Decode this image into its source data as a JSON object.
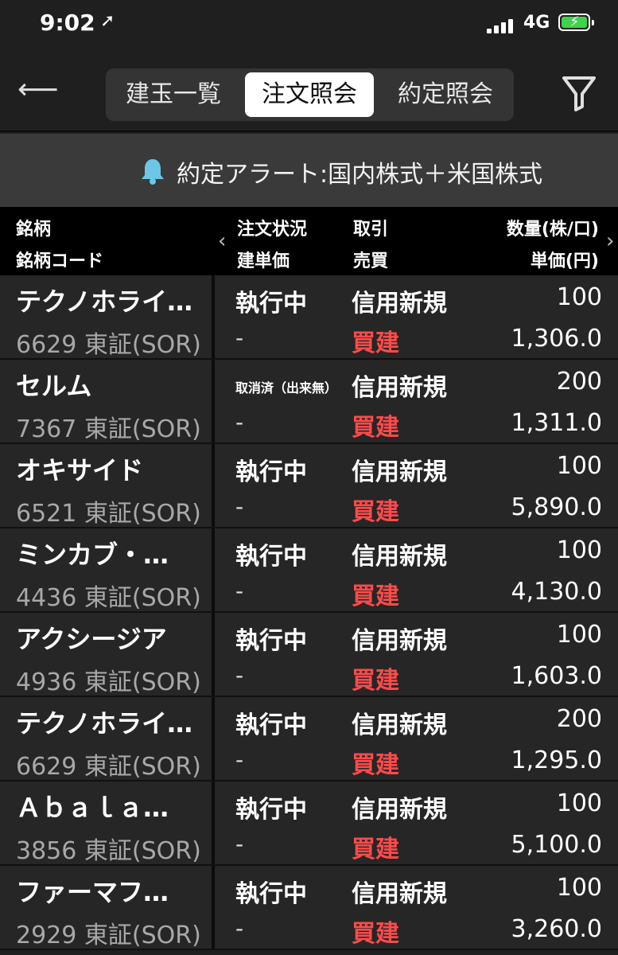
{
  "status_bar": {
    "time": "9:02",
    "network": "4G"
  },
  "nav": {
    "tabs": [
      "建玉一覧",
      "注文照会",
      "約定照会"
    ],
    "active_tab": 1
  },
  "alert": {
    "text": "約定アラート:国内株式＋米国株式"
  },
  "table": {
    "headers": {
      "name": "銘柄",
      "code": "銘柄コード",
      "status": "注文状況",
      "price": "建単価",
      "trade": "取引",
      "side": "売買",
      "qty": "数量(株/口)",
      "unit_price": "単価(円)"
    },
    "rows": [
      {
        "name": "テクノホライ…",
        "code": "6629 東証(SOR)",
        "status": "執行中",
        "price": "-",
        "trade": "信用新規",
        "side": "買建",
        "qty": "100",
        "unit_price": "1,306.0"
      },
      {
        "name": "セルム",
        "code": "7367 東証(SOR)",
        "status": "取消済（出来無）",
        "price": "-",
        "trade": "信用新規",
        "side": "買建",
        "qty": "200",
        "unit_price": "1,311.0"
      },
      {
        "name": "オキサイド",
        "code": "6521 東証(SOR)",
        "status": "執行中",
        "price": "-",
        "trade": "信用新規",
        "side": "買建",
        "qty": "100",
        "unit_price": "5,890.0"
      },
      {
        "name": "ミンカブ・…",
        "code": "4436 東証(SOR)",
        "status": "執行中",
        "price": "-",
        "trade": "信用新規",
        "side": "買建",
        "qty": "100",
        "unit_price": "4,130.0"
      },
      {
        "name": "アクシージア",
        "code": "4936 東証(SOR)",
        "status": "執行中",
        "price": "-",
        "trade": "信用新規",
        "side": "買建",
        "qty": "100",
        "unit_price": "1,603.0"
      },
      {
        "name": "テクノホライ…",
        "code": "6629 東証(SOR)",
        "status": "執行中",
        "price": "-",
        "trade": "信用新規",
        "side": "買建",
        "qty": "200",
        "unit_price": "1,295.0"
      },
      {
        "name": "Ａｂａｌａ…",
        "code": "3856 東証(SOR)",
        "status": "執行中",
        "price": "-",
        "trade": "信用新規",
        "side": "買建",
        "qty": "100",
        "unit_price": "5,100.0"
      },
      {
        "name": "ファーマフ…",
        "code": "2929 東証(SOR)",
        "status": "執行中",
        "price": "-",
        "trade": "信用新規",
        "side": "買建",
        "qty": "100",
        "unit_price": "3,260.0"
      }
    ]
  },
  "colors": {
    "buy": "#ff4a4a",
    "bell": "#6cc6e6",
    "battery": "#3ed34a"
  }
}
